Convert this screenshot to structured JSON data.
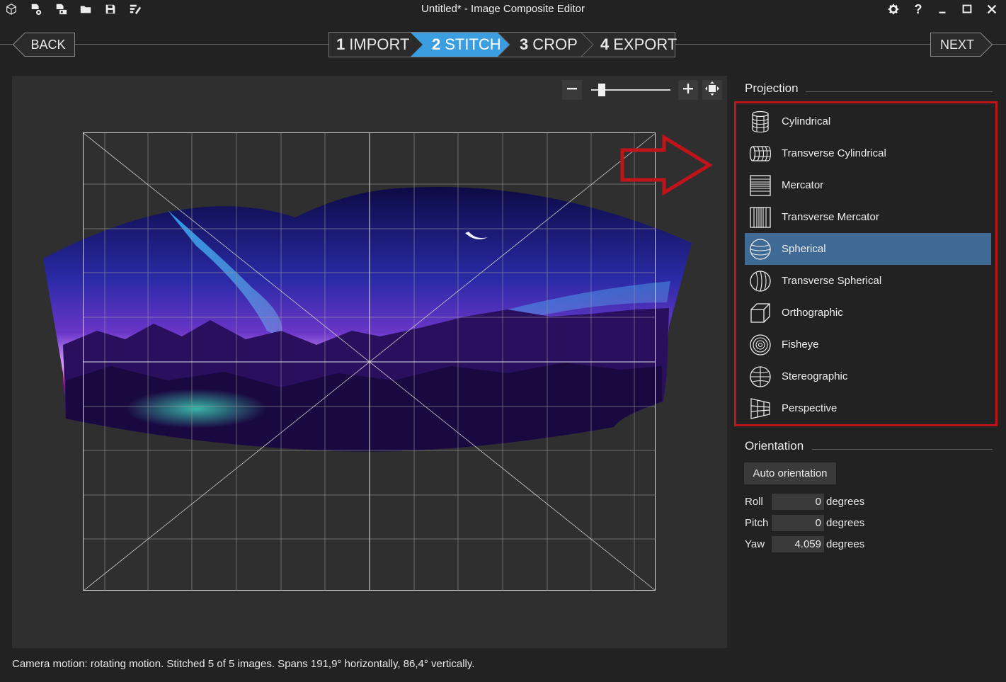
{
  "window": {
    "title": "Untitled* - Image Composite Editor",
    "toolbar_icons": [
      "app-logo-icon",
      "new-panorama-icon",
      "new-video-panorama-icon",
      "open-folder-icon",
      "save-icon",
      "save-as-icon"
    ],
    "controls": [
      "settings-icon",
      "help-icon",
      "minimize-icon",
      "maximize-icon",
      "close-icon"
    ]
  },
  "nav": {
    "back_label": "BACK",
    "next_label": "NEXT",
    "steps": [
      {
        "num": "1",
        "label": "IMPORT",
        "active": false
      },
      {
        "num": "2",
        "label": "STITCH",
        "active": true
      },
      {
        "num": "3",
        "label": "CROP",
        "active": false
      },
      {
        "num": "4",
        "label": "EXPORT",
        "active": false
      }
    ],
    "active_color": "#3a9ee0"
  },
  "zoom": {
    "minus_icon": "zoom-out-icon",
    "plus_icon": "zoom-in-icon",
    "fit_icon": "fit-to-window-icon",
    "level": 0.1
  },
  "projection": {
    "title": "Projection",
    "items": [
      {
        "label": "Cylindrical",
        "icon": "cylindrical-icon",
        "selected": false
      },
      {
        "label": "Transverse Cylindrical",
        "icon": "transverse-cylindrical-icon",
        "selected": false
      },
      {
        "label": "Mercator",
        "icon": "mercator-icon",
        "selected": false
      },
      {
        "label": "Transverse Mercator",
        "icon": "transverse-mercator-icon",
        "selected": false
      },
      {
        "label": "Spherical",
        "icon": "spherical-icon",
        "selected": true
      },
      {
        "label": "Transverse Spherical",
        "icon": "transverse-spherical-icon",
        "selected": false
      },
      {
        "label": "Orthographic",
        "icon": "orthographic-icon",
        "selected": false
      },
      {
        "label": "Fisheye",
        "icon": "fisheye-icon",
        "selected": false
      },
      {
        "label": "Stereographic",
        "icon": "stereographic-icon",
        "selected": false
      },
      {
        "label": "Perspective",
        "icon": "perspective-icon",
        "selected": false
      }
    ],
    "highlight_color": "#c0141a",
    "selected_color": "#3e6a95"
  },
  "orientation": {
    "title": "Orientation",
    "auto_label": "Auto orientation",
    "rows": [
      {
        "label": "Roll",
        "value": "0",
        "unit": "degrees"
      },
      {
        "label": "Pitch",
        "value": "0",
        "unit": "degrees"
      },
      {
        "label": "Yaw",
        "value": "4.059",
        "unit": "degrees"
      }
    ]
  },
  "status": {
    "text": "Camera motion: rotating motion. Stitched 5 of 5 images. Spans 191,9° horizontally, 86,4° vertically."
  }
}
